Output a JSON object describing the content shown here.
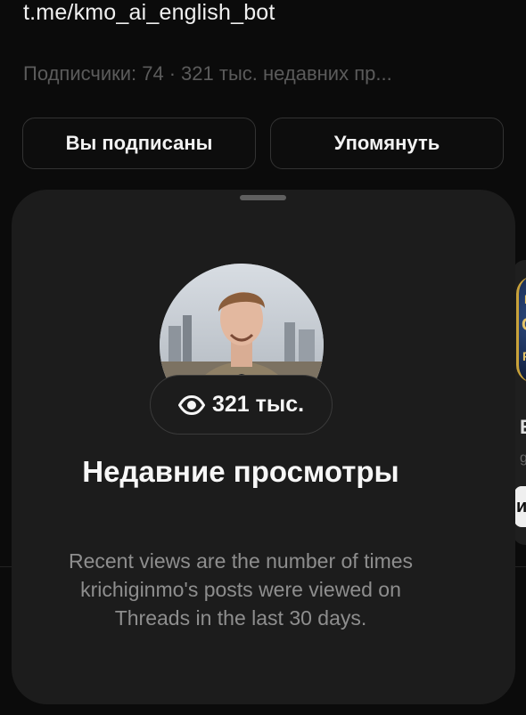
{
  "profile": {
    "link": "t.me/kmo_ai_english_bot",
    "followers_label": "Подписчики: 74",
    "separator": "·",
    "recent_views_short": "321 тыс. недавних пр..."
  },
  "actions": {
    "following_label": "Вы подписаны",
    "mention_label": "Упомянуть"
  },
  "side_card": {
    "thumb_text_top": "EA",
    "thumb_text_mid": "C",
    "thumb_text_bottom": "R",
    "title_letter": "E",
    "subtitle_letter": "g",
    "button_letter": "и"
  },
  "sheet": {
    "views_count": "321 тыс.",
    "title": "Недавние просмотры",
    "description": "Recent views are the number of times krichiginmo's posts were viewed on Threads in the last 30 days."
  },
  "icons": {
    "eye": "eye-icon"
  },
  "colors": {
    "background": "#0b0b0b",
    "sheet": "#1c1c1c",
    "muted_text": "#8e8e8e"
  }
}
